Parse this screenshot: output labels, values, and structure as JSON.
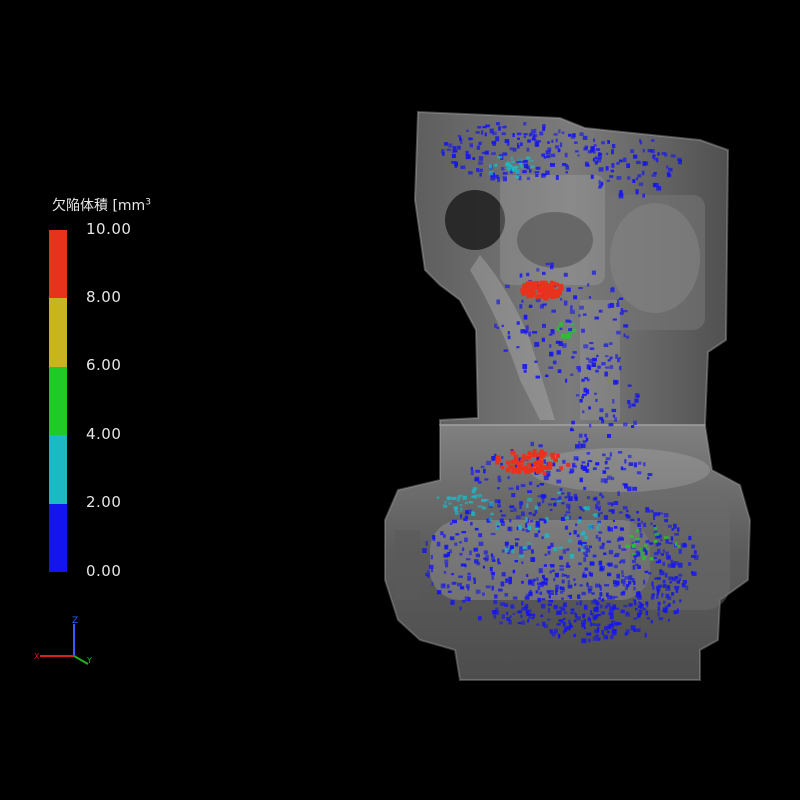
{
  "legend": {
    "title": "欠陥体積 [mm",
    "title_superscript": "3",
    "ticks": [
      "10.00",
      "8.00",
      "6.00",
      "4.00",
      "2.00",
      "0.00"
    ],
    "bands": [
      {
        "range": "8.00-10.00",
        "color": "#e8321c"
      },
      {
        "range": "6.00-8.00",
        "color": "#c8b41e"
      },
      {
        "range": "4.00-6.00",
        "color": "#20c828"
      },
      {
        "range": "2.00-4.00",
        "color": "#1cb8c4"
      },
      {
        "range": "0.00-2.00",
        "color": "#1414f0"
      }
    ]
  },
  "axes_triad": {
    "labels": [
      "Z",
      "X",
      "Y"
    ],
    "colors": {
      "x": "#d02020",
      "y": "#20b020",
      "z": "#3060ff"
    }
  },
  "model": {
    "part_color": "#8a8a8a",
    "background": "#000000"
  }
}
